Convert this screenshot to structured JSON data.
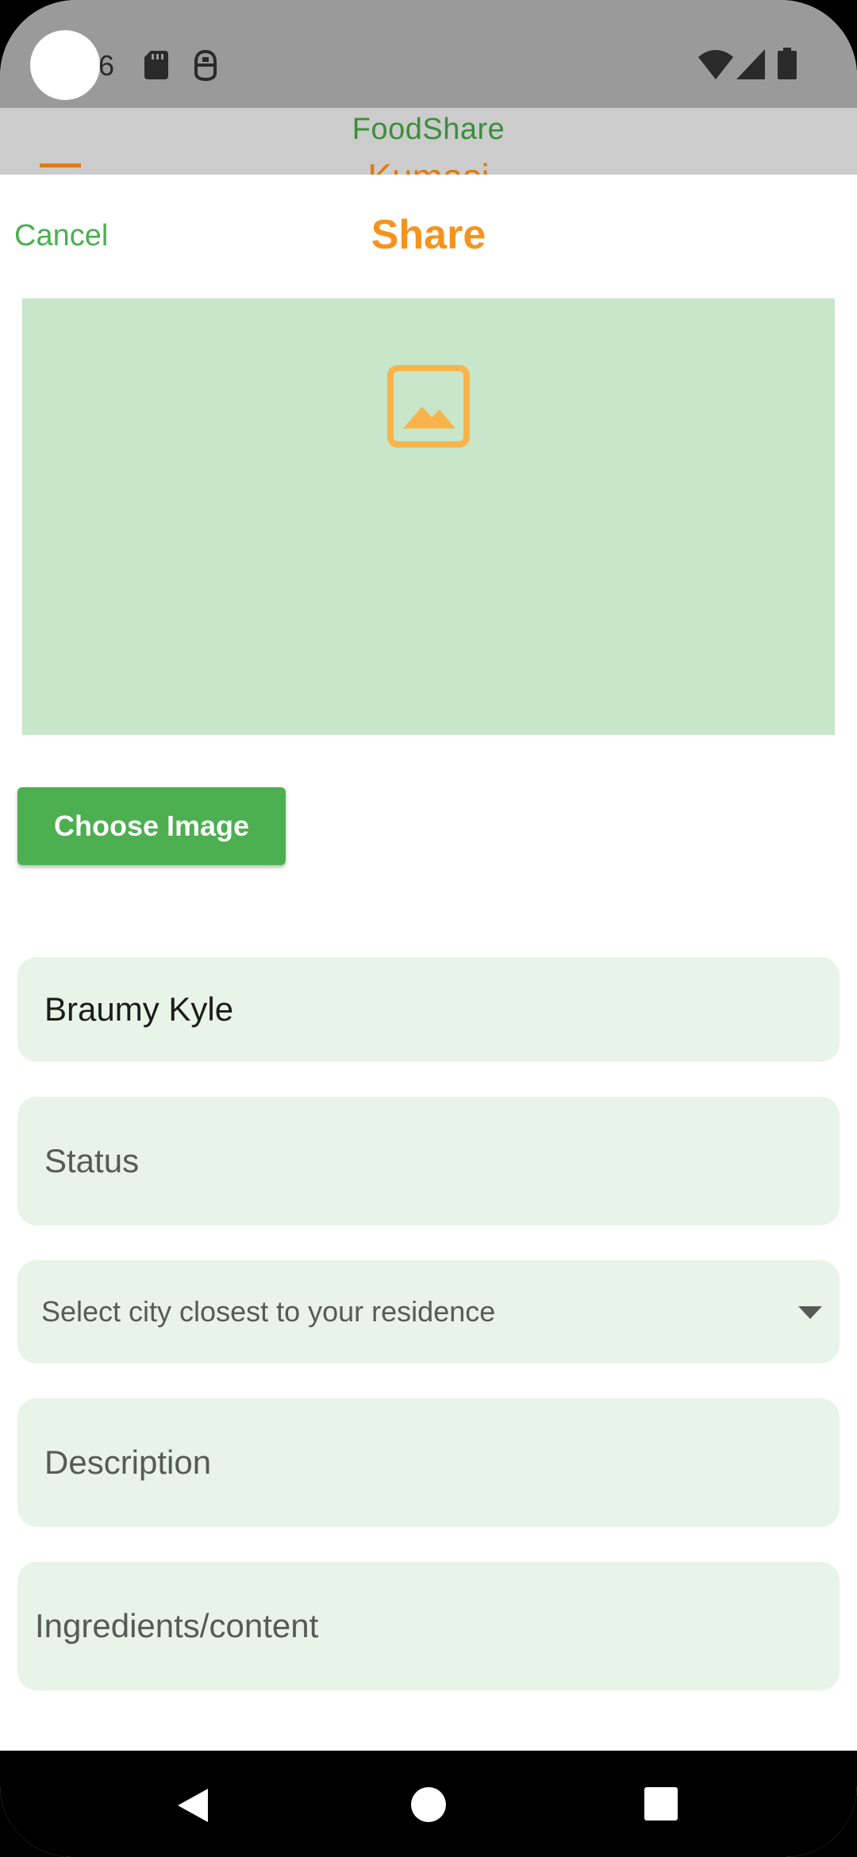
{
  "status_bar": {
    "time_partial": "6",
    "icons": [
      "sd-card-icon",
      "sim-icon",
      "wifi-icon",
      "cell-signal-icon",
      "battery-icon"
    ]
  },
  "app_bar": {
    "title": "FoodShare",
    "location": "Kumasi",
    "menu_icon": "hamburger-menu-icon"
  },
  "sheet": {
    "cancel_label": "Cancel",
    "title": "Share",
    "image_placeholder_icon": "image-icon",
    "choose_image_label": "Choose Image"
  },
  "form": {
    "name_value": "Braumy Kyle",
    "status_placeholder": "Status",
    "city_placeholder": "Select city closest to your residence",
    "description_placeholder": "Description",
    "ingredients_placeholder": "Ingredients/content"
  },
  "nav_bar": {
    "icons": [
      "back-icon",
      "home-icon",
      "recents-icon"
    ]
  },
  "colors": {
    "accent_green": "#4caf50",
    "accent_orange": "#f5941d",
    "preview_bg": "#c8e6c9",
    "field_bg": "#e8f4e8",
    "status_bar_bg": "#9a9a9a"
  }
}
